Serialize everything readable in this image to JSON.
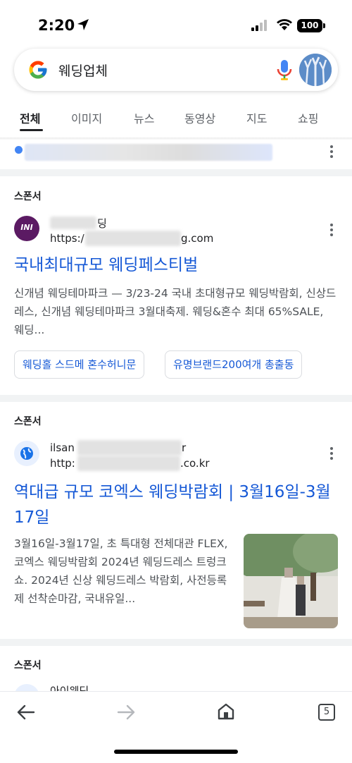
{
  "status_bar": {
    "time": "2:20",
    "battery": "100"
  },
  "search": {
    "query": "웨딩업체"
  },
  "tabs": [
    {
      "label": "전체",
      "active": true
    },
    {
      "label": "이미지"
    },
    {
      "label": "뉴스"
    },
    {
      "label": "동영상"
    },
    {
      "label": "지도"
    },
    {
      "label": "쇼핑"
    }
  ],
  "ads": [
    {
      "sponsor_label": "스폰서",
      "favicon_text": "INI",
      "site_name_visible": "딩",
      "url_prefix": "https:/",
      "url_suffix": "g.com",
      "title": "국내최대규모 웨딩페스티벌",
      "description": "신개념 웨딩테마파크 — 3/23-24 국내 초대형규모 웨딩박람회, 신상드레스, 신개념 웨딩테마파크 3월대축제. 웨딩&혼수 최대 65%SALE, 웨딩...",
      "sitelinks": [
        "웨딩홀 스드메 혼수허니문",
        "유명브랜드200여개 총출동"
      ]
    },
    {
      "sponsor_label": "스폰서",
      "site_name_prefix": "ilsan",
      "site_name_suffix": "r",
      "url_prefix": "http:",
      "url_suffix": ".co.kr",
      "title": "역대급 규모 코엑스 웨딩박람회 | 3월16일-3월17일",
      "description": "3월16일-3월17일, 초 특대형 전체대관 FLEX, 코엑스 웨딩박람회 2024년 웨딩드레스 트렁크쇼. 2024년 신상 웨딩드레스 박람회, 사전등록제 선착순마감, 국내유일..."
    },
    {
      "sponsor_label": "스폰서",
      "site_name": "아이웨딩"
    }
  ],
  "bottom_bar": {
    "tab_count": "5"
  },
  "colors": {
    "link": "#1558d6",
    "separator": "#f1f3f4",
    "favicon_ini": "#5b1a63"
  }
}
